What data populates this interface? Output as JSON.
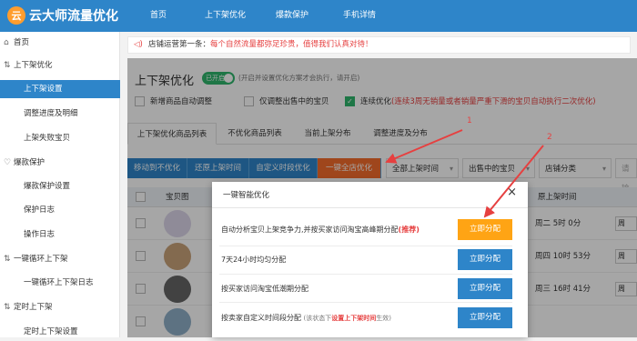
{
  "brand": {
    "name": "云大师流量优化",
    "mark": "云"
  },
  "nav": [
    "首页",
    "上下架优化",
    "爆款保护",
    "手机详情"
  ],
  "sidebar": {
    "home": "首页",
    "g1": "上下架优化",
    "g1_items": [
      "上下架设置",
      "调整进度及明细",
      "上架失败宝贝"
    ],
    "g2": "爆款保护",
    "g2_items": [
      "爆款保护设置",
      "保护日志",
      "操作日志"
    ],
    "g3": "一键循环上下架",
    "g3_items": [
      "一键循环上下架日志"
    ],
    "g4": "定时上下架",
    "g4_items": [
      "定时上下架设置"
    ]
  },
  "notice": {
    "label": "店铺运营第一条：",
    "text": "每个自然流量都弥足珍贵，值得我们认真对待！"
  },
  "page": {
    "title": "上下架优化",
    "toggle": "已开启",
    "hint": "(开启并设置优化方案才会执行，请开启)"
  },
  "options": {
    "new_goods": "新增商品自动调整",
    "onsale_only": "仅调整出售中的宝贝",
    "continuous": "连续优化",
    "continuous_note": "(连续3周无销量或者销量严重下滑的宝贝自动执行二次优化)"
  },
  "tabs": [
    "上下架优化商品列表",
    "不优化商品列表",
    "当前上架分布",
    "调整进度及分布"
  ],
  "actions": [
    "移动到不优化",
    "还原上架时间",
    "自定义时段优化",
    "一键全店优化"
  ],
  "filters": [
    {
      "label": "全部上架时间"
    },
    {
      "label": "出售中的宝贝"
    },
    {
      "label": "店铺分类"
    },
    {
      "placeholder": "请输"
    }
  ],
  "table": {
    "headers": [
      "宝贝图",
      "原上架时间"
    ],
    "rows": [
      {
        "time": "周二 5时 0分",
        "mini": "周"
      },
      {
        "time": "周四 10时 53分",
        "mini": "周"
      },
      {
        "time": "周三 16时 41分",
        "mini": "周"
      },
      {
        "time": "",
        "mini": ""
      }
    ]
  },
  "dialog": {
    "title": "一键智能优化",
    "close": "×",
    "items": [
      {
        "text": "自动分析宝贝上架竞争力,并按买家访问淘宝高峰期分配",
        "rec": "(推荐)",
        "button": "立即分配"
      },
      {
        "text": "7天24小时均匀分配",
        "button": "立即分配"
      },
      {
        "text": "按买家访问淘宝低潮期分配",
        "button": "立即分配"
      },
      {
        "text": "按卖家自定义时间段分配",
        "sm1": "(该状态下",
        "sm_red": "设置上下架时间",
        "sm2": "生效)",
        "button": "立即分配"
      }
    ]
  },
  "annotations": [
    "1",
    "2"
  ],
  "colors": {
    "primary": "#2e85c9",
    "accent": "#f46c2c",
    "red": "#e64040",
    "green": "#2fb56c",
    "warn": "#ffa414"
  }
}
